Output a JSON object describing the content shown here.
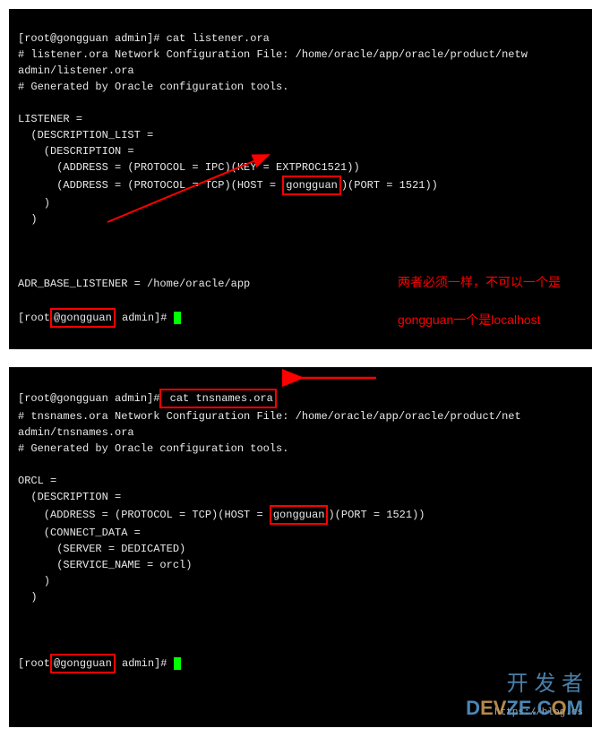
{
  "terminal1": {
    "prompt1_user": "[root",
    "prompt1_at": "@gongguan",
    "prompt1_path": " admin]#",
    "cmd1": " cat listener.ora",
    "line2": "# listener.ora Network Configuration File: /home/oracle/app/oracle/product/netw",
    "line3": "admin/listener.ora",
    "line4": "# Generated by Oracle configuration tools.",
    "line6": "LISTENER =",
    "line7": "  (DESCRIPTION_LIST =",
    "line8": "    (DESCRIPTION =",
    "line9": "      (ADDRESS = (PROTOCOL = IPC)(KEY = EXTPROC1521))",
    "line10a": "      (ADDRESS = (PROTOCOL = TCP)(HOST = ",
    "line10_host": "gongguan",
    "line10b": ")(PORT = 1521))",
    "line11": "    )",
    "line12": "  )",
    "line14": "ADR_BASE_LISTENER = /home/oracle/app",
    "prompt2_user": "[root",
    "prompt2_at": "@gongguan",
    "prompt2_path": " admin]#",
    "annotation1": "两者必须一样，不可以一个是",
    "annotation2": "gongguan一个是localhost"
  },
  "terminal2": {
    "prompt1_user": "[root",
    "prompt1_at": "@gongguan",
    "prompt1_path": " admin]#",
    "cmd1": " cat tnsnames.ora",
    "line2": "# tnsnames.ora Network Configuration File: /home/oracle/app/oracle/product/net",
    "line3": "admin/tnsnames.ora",
    "line4": "# Generated by Oracle configuration tools.",
    "line6": "ORCL =",
    "line7": "  (DESCRIPTION =",
    "line8a": "    (ADDRESS = (PROTOCOL = TCP)(HOST = ",
    "line8_host": "gongguan",
    "line8b": ")(PORT = 1521))",
    "line9": "    (CONNECT_DATA =",
    "line10": "      (SERVER = DEDICATED)",
    "line11": "      (SERVICE_NAME = orcl)",
    "line12": "    )",
    "line13": "  )",
    "prompt2_user": "[root",
    "prompt2_at": "@gongguan",
    "prompt2_path": " admin]#",
    "watermark": "开 发 者",
    "devze": "DEVZE.COM",
    "blog_url": "https://blog.cs"
  }
}
